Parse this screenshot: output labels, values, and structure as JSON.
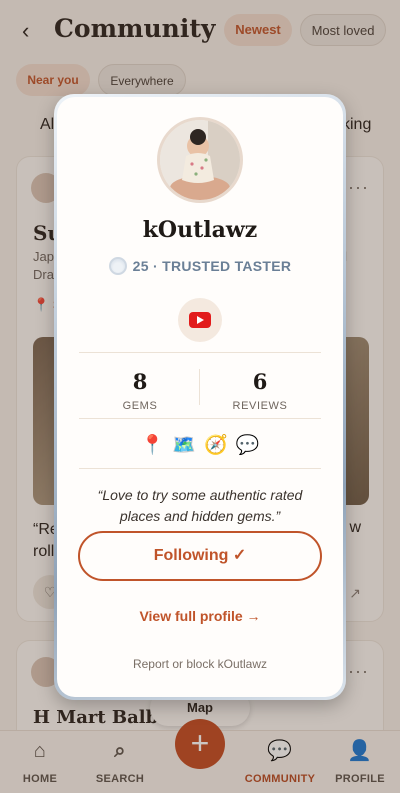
{
  "header": {
    "back_glyph": "‹",
    "title": "Community"
  },
  "sort_tabs": [
    "Newest",
    "Most loved"
  ],
  "location_tabs": [
    "Near you",
    "Everywhere"
  ],
  "category_partial": {
    "left": "Al",
    "right": "king"
  },
  "feed": {
    "card1": {
      "title_partial": "Su",
      "sub_line1": "Japa",
      "sub_line2": "Drag",
      "sub_right": "d",
      "pin": "📍 S",
      "quote_left": "“Re",
      "quote_left2": "roll",
      "quote_right": "w"
    },
    "card2": {
      "title": "H Mart Balboa"
    },
    "map_button": "Map"
  },
  "bottom_nav": {
    "home": "HOME",
    "search": "SEARCH",
    "community": "COMMUNITY",
    "profile": "PROFILE",
    "fab": "+"
  },
  "profile_modal": {
    "username": "kOutlawz",
    "level": "25",
    "rank": "TRUSTED TASTER",
    "level_line": "25 · TRUSTED TASTER",
    "social_icon": "youtube-icon",
    "stats": [
      {
        "value": "8",
        "label": "GEMS"
      },
      {
        "value": "6",
        "label": "REVIEWS"
      }
    ],
    "badges": [
      "📍",
      "🗺️",
      "🧭",
      "💬"
    ],
    "bio": "“Love to try some authentic rated places and hidden gems.”",
    "follow_button": "Following ✓",
    "view_profile": "View full profile →",
    "report": "Report or block kOutlawz"
  },
  "colors": {
    "accent": "#c0542a",
    "fab": "#c34a20",
    "rank_text": "#6a7f96",
    "youtube_red": "#e21b1b"
  }
}
